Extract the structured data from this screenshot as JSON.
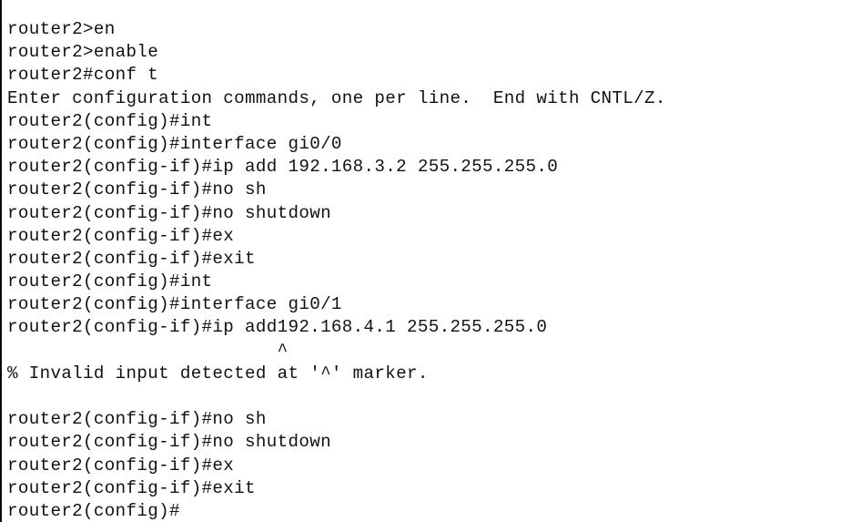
{
  "terminal": {
    "device_hostname": "router2",
    "background_color": "#ffffff",
    "text_color": "#111111",
    "border_color": "#0a0a0a",
    "lines": [
      {
        "id": "line-01",
        "text": "router2>en"
      },
      {
        "id": "line-02",
        "text": "router2>enable"
      },
      {
        "id": "line-03",
        "text": "router2#conf t"
      },
      {
        "id": "line-04",
        "text": "Enter configuration commands, one per line.  End with CNTL/Z."
      },
      {
        "id": "line-05",
        "text": "router2(config)#int"
      },
      {
        "id": "line-06",
        "text": "router2(config)#interface gi0/0"
      },
      {
        "id": "line-07",
        "text": "router2(config-if)#ip add 192.168.3.2 255.255.255.0"
      },
      {
        "id": "line-08",
        "text": "router2(config-if)#no sh"
      },
      {
        "id": "line-09",
        "text": "router2(config-if)#no shutdown"
      },
      {
        "id": "line-10",
        "text": "router2(config-if)#ex"
      },
      {
        "id": "line-11",
        "text": "router2(config-if)#exit"
      },
      {
        "id": "line-12",
        "text": "router2(config)#int"
      },
      {
        "id": "line-13",
        "text": "router2(config)#interface gi0/1"
      },
      {
        "id": "line-14",
        "text": "router2(config-if)#ip add192.168.4.1 255.255.255.0"
      },
      {
        "id": "line-15",
        "text": "                         ^"
      },
      {
        "id": "line-16",
        "text": "% Invalid input detected at '^' marker."
      },
      {
        "id": "line-17",
        "text": ""
      },
      {
        "id": "line-18",
        "text": "router2(config-if)#no sh"
      },
      {
        "id": "line-19",
        "text": "router2(config-if)#no shutdown"
      },
      {
        "id": "line-20",
        "text": "router2(config-if)#ex"
      },
      {
        "id": "line-21",
        "text": "router2(config-if)#exit"
      },
      {
        "id": "line-22",
        "text": "router2(config)#"
      }
    ]
  }
}
